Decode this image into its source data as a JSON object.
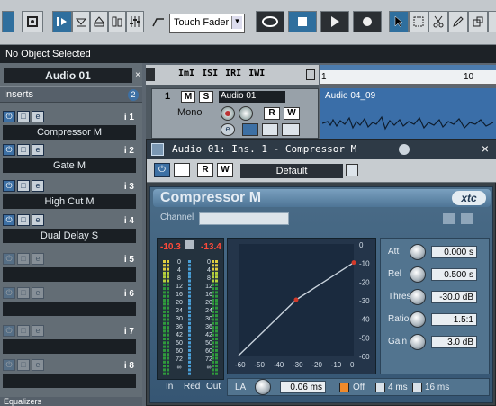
{
  "toolbar": {
    "automation_mode": "Touch Fader",
    "dropdown_arrow": "▾"
  },
  "status": {
    "text": "No Object Selected"
  },
  "channel": {
    "name": "Audio 01",
    "close_glyph": "×"
  },
  "inserts": {
    "label": "Inserts",
    "badge": "2",
    "slots": [
      {
        "num": "i 1",
        "name": "Compressor M"
      },
      {
        "num": "i 2",
        "name": "Gate M"
      },
      {
        "num": "i 3",
        "name": "High Cut M"
      },
      {
        "num": "i 4",
        "name": "Dual Delay S"
      },
      {
        "num": "i 5",
        "name": ""
      },
      {
        "num": "i 6",
        "name": ""
      },
      {
        "num": "i 7",
        "name": ""
      },
      {
        "num": "i 8",
        "name": ""
      }
    ]
  },
  "sends": {
    "label": "Equalizers"
  },
  "tracklist_header": {
    "tools": [
      "ImI",
      "ISI",
      "IRI",
      "IWI"
    ]
  },
  "track": {
    "number": "1",
    "mute": "M",
    "solo": "S",
    "name": "Audio 01",
    "mode": "Mono",
    "read": "R",
    "write": "W"
  },
  "ruler": {
    "start": "1",
    "mark": "10"
  },
  "event": {
    "name": "Audio 04_09"
  },
  "plugin": {
    "window_title": "Audio 01: Ins. 1 - Compressor M",
    "close_glyph": "×",
    "read": "R",
    "write": "W",
    "preset": "Default",
    "name": "Compressor M",
    "logo": "xtc",
    "channel_label": "Channel",
    "meters": {
      "left_peak": "-10.3",
      "right_peak": "-13.4",
      "scale": [
        "0",
        "4",
        "8",
        "12",
        "16",
        "20",
        "24",
        "30",
        "36",
        "42",
        "50",
        "60",
        "72",
        "∞"
      ],
      "in_label": "In",
      "red_label": "Red",
      "out_label": "Out"
    },
    "graph": {
      "y_ticks": [
        "0",
        "-10",
        "-20",
        "-30",
        "-40",
        "-50",
        "-60"
      ],
      "x_ticks": [
        "-60",
        "-50",
        "-40",
        "-30",
        "-20",
        "-10",
        "0"
      ]
    },
    "params": [
      {
        "label": "Att",
        "value": "0.000 s"
      },
      {
        "label": "Rel",
        "value": "0.500 s"
      },
      {
        "label": "Thres",
        "value": "-30.0 dB"
      },
      {
        "label": "Ratio",
        "value": "1.5:1"
      },
      {
        "label": "Gain",
        "value": "3.0 dB"
      }
    ],
    "la": {
      "label": "LA",
      "value": "0.06 ms",
      "off": "Off",
      "opt4": "4 ms",
      "opt16": "16 ms"
    }
  },
  "colors": {
    "accent_blue": "#3d70a4",
    "meter_peak_red": "#ff4a3a",
    "curve": "#c8d2dc",
    "point": "#d23a2a"
  }
}
